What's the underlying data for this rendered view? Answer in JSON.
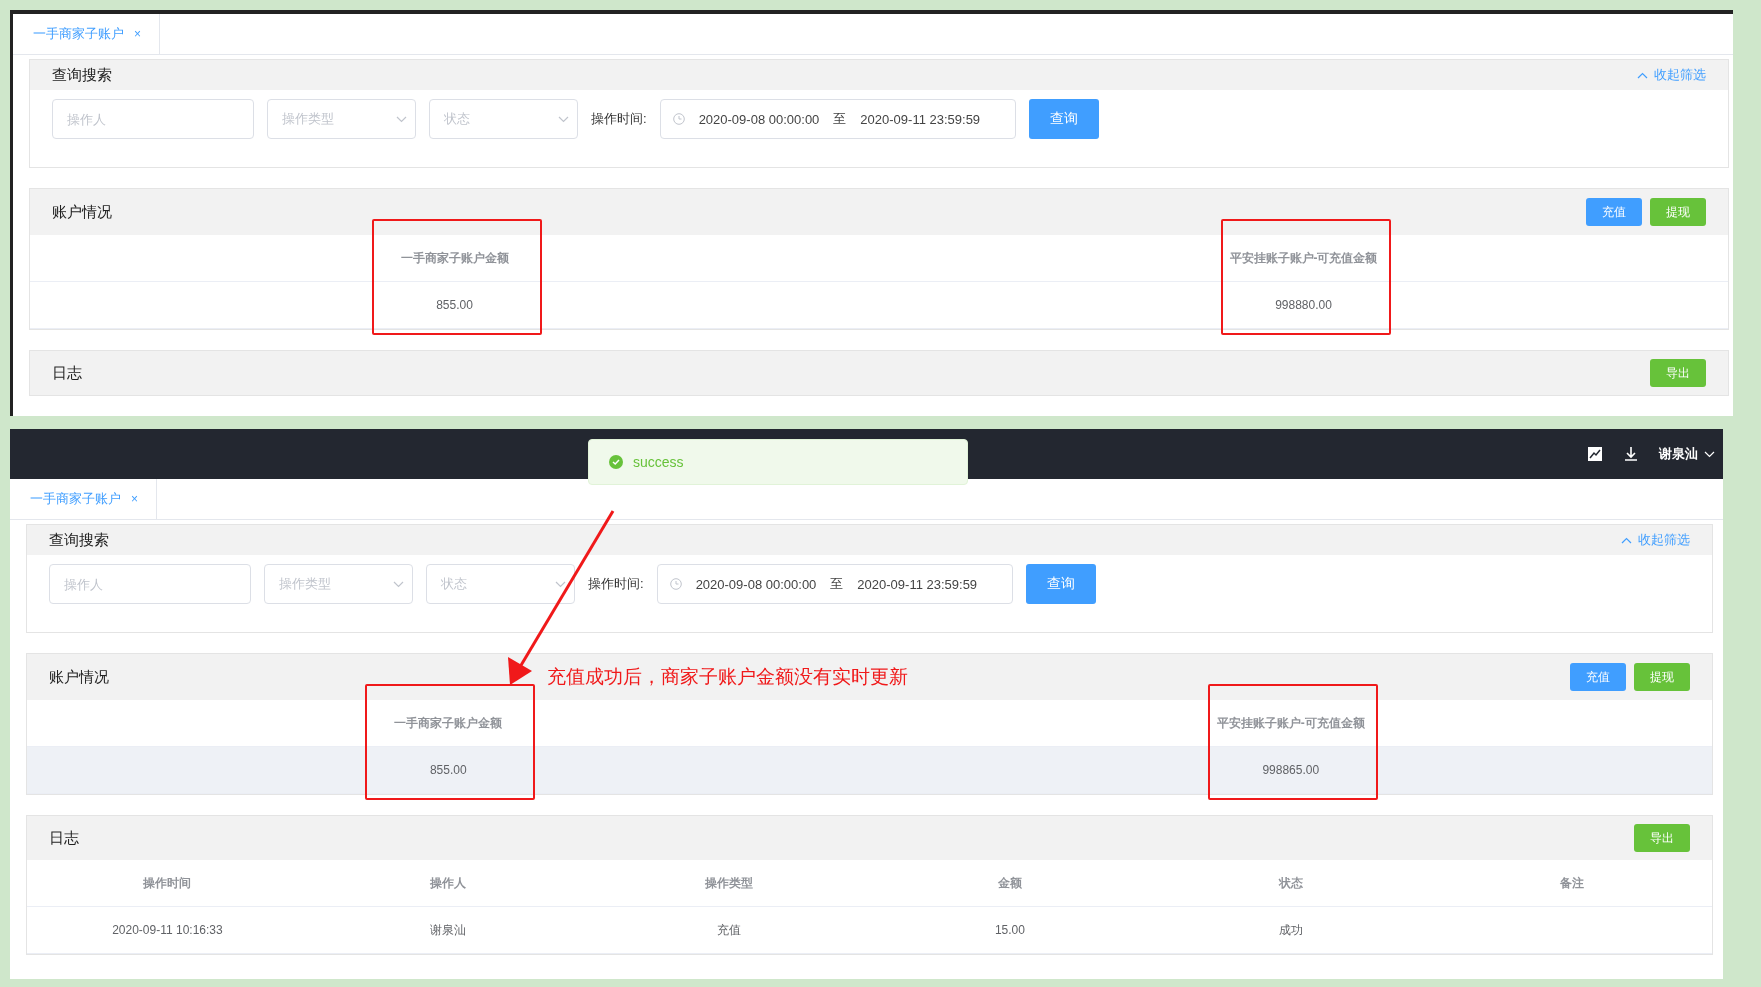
{
  "screenshots": [
    {
      "tabs": [
        {
          "label": "一手商家子账户",
          "close": "×",
          "selected": true
        }
      ],
      "search": {
        "title": "查询搜索",
        "collapse": "收起筛选",
        "operator": {
          "placeholder": "操作人"
        },
        "type": {
          "placeholder": "操作类型"
        },
        "status": {
          "placeholder": "状态"
        },
        "time_label": "操作时间:",
        "start": "2020-09-08 00:00:00",
        "separator": "至",
        "end": "2020-09-11 23:59:59",
        "button": "查询"
      },
      "account": {
        "title": "账户情况",
        "buttons": [
          {
            "label": "充值",
            "kind": "primary"
          },
          {
            "label": "提现",
            "kind": "success"
          }
        ],
        "row_hovered": false,
        "columns": [
          {
            "heading": "一手商家子账户金额",
            "value": "855.00",
            "highlighted": true
          },
          {
            "heading": "平安挂账子账户-可充值金额",
            "value": "998880.00",
            "highlighted": true
          }
        ]
      },
      "log": {
        "title": "日志",
        "button": "导出"
      }
    },
    {
      "header": {
        "user": "谢泉汕",
        "toast": "success"
      },
      "tabs": [
        {
          "label": "一手商家子账户",
          "close": "×",
          "selected": true
        }
      ],
      "search": {
        "title": "查询搜索",
        "collapse": "收起筛选",
        "operator": {
          "placeholder": "操作人"
        },
        "type": {
          "placeholder": "操作类型"
        },
        "status": {
          "placeholder": "状态"
        },
        "time_label": "操作时间:",
        "start": "2020-09-08 00:00:00",
        "separator": "至",
        "end": "2020-09-11 23:59:59",
        "button": "查询"
      },
      "account": {
        "title": "账户情况",
        "buttons": [
          {
            "label": "充值",
            "kind": "primary"
          },
          {
            "label": "提现",
            "kind": "success"
          }
        ],
        "row_hovered": true,
        "columns": [
          {
            "heading": "一手商家子账户金额",
            "value": "855.00",
            "highlighted": true
          },
          {
            "heading": "平安挂账子账户-可充值金额",
            "value": "998865.00",
            "highlighted": true
          }
        ]
      },
      "annotation": {
        "text": "充值成功后，商家子账户金额没有实时更新"
      },
      "log": {
        "title": "日志",
        "button": "导出",
        "columns": [
          "操作时间",
          "操作人",
          "操作类型",
          "金额",
          "状态",
          "备注"
        ],
        "rows": [
          [
            "2020-09-11 10:16:33",
            "谢泉汕",
            "充值",
            "15.00",
            "成功",
            ""
          ]
        ]
      }
    }
  ]
}
